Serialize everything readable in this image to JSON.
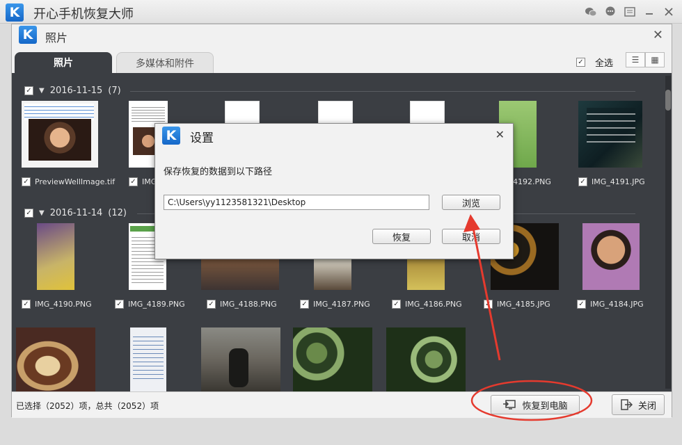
{
  "app": {
    "title": "开心手机恢复大师",
    "logo": "K"
  },
  "inner": {
    "title": "照片",
    "logo": "K"
  },
  "tabs": [
    {
      "label": "照片",
      "active": true
    },
    {
      "label": "多媒体和附件",
      "active": false
    }
  ],
  "select_all": "全选",
  "groups": [
    {
      "date": "2016-11-15",
      "count": "(7)"
    },
    {
      "date": "2016-11-14",
      "count": "(12)"
    }
  ],
  "row1_captions": [
    "PreviewWellImage.tif",
    "IMG_4196",
    "",
    "",
    "",
    "4192.PNG",
    "IMG_4191.JPG"
  ],
  "row2_captions": [
    "IMG_4190.PNG",
    "IMG_4189.PNG",
    "IMG_4188.PNG",
    "IMG_4187.PNG",
    "IMG_4186.PNG",
    "IMG_4185.JPG",
    "IMG_4184.JPG"
  ],
  "footer": {
    "status": "已选择（2052）项，总共（2052）项",
    "recover_btn": "恢复到电脑",
    "close_btn": "关闭"
  },
  "dialog": {
    "title": "设置",
    "logo": "K",
    "label": "保存恢复的数据到以下路径",
    "path": "C:\\Users\\yy1123581321\\Desktop",
    "browse": "浏览",
    "recover": "恢复",
    "cancel": "取消"
  },
  "colors": {
    "accent_red": "#e53a2e",
    "panel_dark": "#3b3e43",
    "logo_blue": "#1f77d8"
  }
}
